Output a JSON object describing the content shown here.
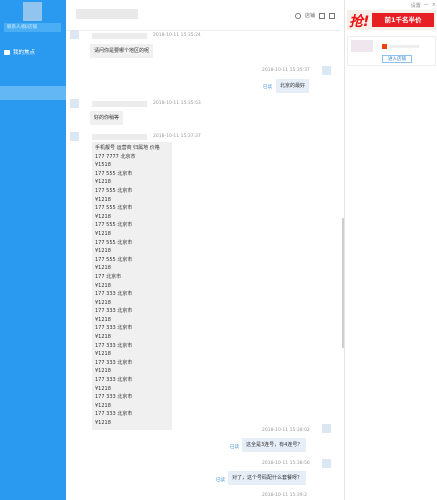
{
  "sidebar": {
    "search_placeholder": "联系人/群/店铺",
    "focus_label": "我的焦点"
  },
  "topbar": {
    "actions": [
      "店铺",
      "足迹"
    ]
  },
  "messages": [
    {
      "timestamp": "2018-10-11 15:35:24",
      "text": "请问你是要哪个地区的呢"
    },
    {
      "timestamp": "2018-10-11 15:35:37",
      "text": "北京的最好",
      "read": "已读"
    },
    {
      "timestamp": "2018-10-11 15:35:53",
      "text": "好的你稍等"
    },
    {
      "timestamp": "2018-10-11 15:37:37"
    },
    {
      "timestamp": "2018-10-11 15:38:02",
      "text": "这全是3连号，有4连号？",
      "read": "已读"
    },
    {
      "timestamp": "2018-10-11 15:38:56",
      "text": "对了，这个号码配什么套餐呀？",
      "read": "已读"
    },
    {
      "timestamp": "2018-10-11 15:39:2"
    }
  ],
  "number_list": {
    "header": "手机靓号 运营商 归属地 价格",
    "rows": [
      "177 7777 北京市",
      "¥1518",
      "177 555 北京市",
      "¥1218",
      "177 555 北京市",
      "¥1218",
      "177 555 北京市",
      "¥1218",
      "177 555 北京市",
      "¥1218",
      "177 555 北京市",
      "¥1218",
      "177 555 北京市",
      "¥1218",
      "177 北京市",
      "¥1218",
      "177 333 北京市",
      "¥1218",
      "177 333 北京市",
      "¥1218",
      "177 333 北京市",
      "¥1218",
      "177 333 北京市",
      "¥1218",
      "177 333 北京市",
      "¥1218",
      "177 333 北京市",
      "¥1218",
      "177 333 北京市",
      "¥1218",
      "177 333 北京市",
      "¥1218"
    ]
  },
  "right_panel": {
    "window_controls": [
      "设置",
      "—",
      "×"
    ],
    "ad_big": "抢!",
    "ad_text": "前1千名半价",
    "enter_shop": "进入店铺"
  },
  "colors": {
    "sidebar": "#2a9af0",
    "read_status": "#3b8ddd",
    "ad_red": "#e61f25"
  }
}
